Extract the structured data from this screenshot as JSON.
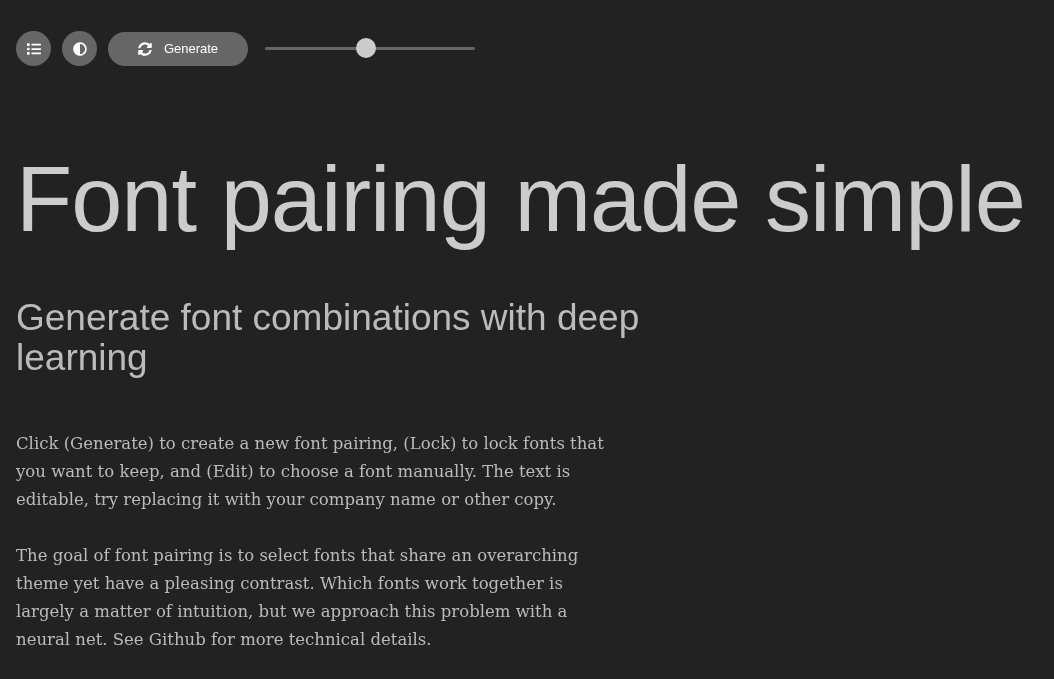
{
  "toolbar": {
    "generate_button": {
      "label": "Generate"
    },
    "slider": {
      "level": 0.48
    }
  },
  "title": "Font pairing made simple",
  "subtitle": "Generate font combinations with deep learning",
  "paragraphs": [
    "Click (Generate) to create a new font pairing, (Lock) to lock fonts that you want to keep, and (Edit) to choose a font manually. The text is editable, try replacing it with your company name or other copy.",
    "The goal of font pairing is to select fonts that share an overarching theme yet have a pleasing contrast. Which fonts work together is largely a matter of intuition, but we approach this problem with a neural net. See Github for more technical details."
  ]
}
